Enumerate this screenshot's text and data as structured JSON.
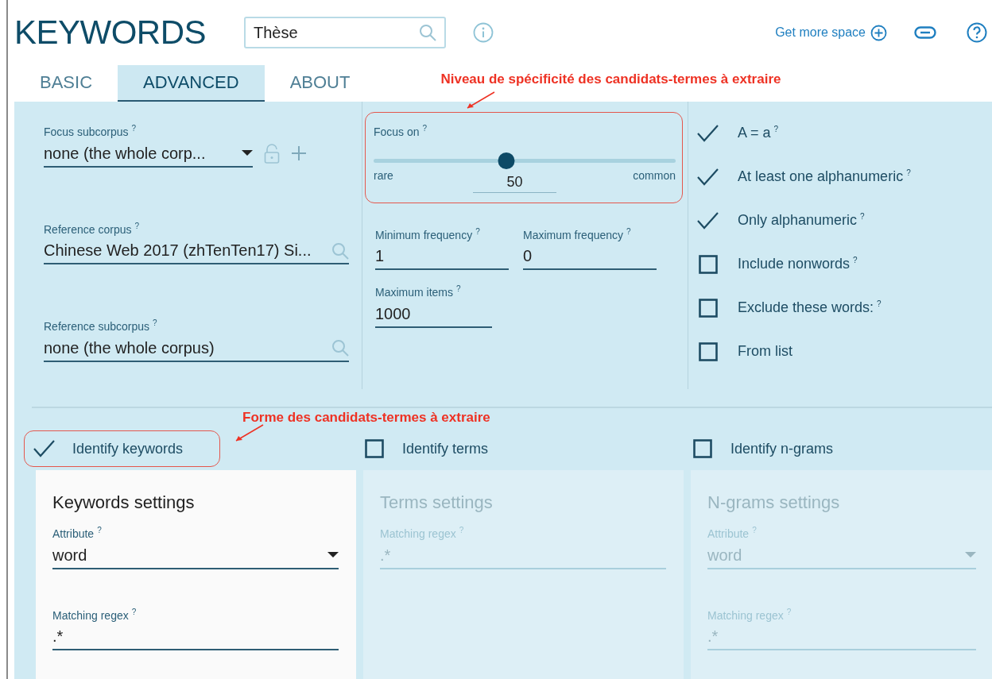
{
  "header": {
    "title": "KEYWORDS",
    "search": {
      "value": "Thèse"
    },
    "get_more_space": "Get more space"
  },
  "tabs": [
    {
      "label": "BASIC",
      "selected": false
    },
    {
      "label": "ADVANCED",
      "selected": true
    },
    {
      "label": "ABOUT",
      "selected": false
    }
  ],
  "annotations": [
    {
      "text": "Niveau de spécificité des candidats-termes à extraire"
    },
    {
      "text": "Forme des candidats-termes à extraire"
    }
  ],
  "corpus_fields": [
    {
      "kind": "dropdown",
      "label": "Focus subcorpus",
      "help_mark": "?",
      "value": "none (the whole corp..."
    },
    {
      "kind": "search",
      "label": "Reference corpus",
      "help_mark": "?",
      "value": "Chinese Web 2017 (zhTenTen17) Si..."
    },
    {
      "kind": "search",
      "label": "Reference subcorpus",
      "help_mark": "?",
      "value": "none (the whole corpus)"
    }
  ],
  "focus_on": {
    "label": "Focus on",
    "help_mark": "?",
    "level": 0.44,
    "min_label": "rare",
    "max_label": "common",
    "value": "50",
    "highlighted": true
  },
  "frequency_fields": [
    {
      "label": "Minimum frequency",
      "help_mark": "?",
      "value": "1"
    },
    {
      "label": "Maximum frequency",
      "help_mark": "?",
      "value": "0"
    },
    {
      "label": "Maximum items",
      "help_mark": "?",
      "value": "1000"
    }
  ],
  "options": [
    {
      "label": "A = a",
      "help_mark": "?",
      "checked": true
    },
    {
      "label": "At least one alphanumeric",
      "help_mark": "?",
      "checked": true
    },
    {
      "label": "Only alphanumeric",
      "help_mark": "?",
      "checked": true
    },
    {
      "label": "Include nonwords",
      "help_mark": "?",
      "checked": false
    },
    {
      "label": "Exclude these words:",
      "help_mark": "?",
      "checked": false
    },
    {
      "label": "From list",
      "checked": false
    }
  ],
  "modes": [
    {
      "label": "Identify keywords",
      "checked": true,
      "highlighted": true
    },
    {
      "label": "Identify terms",
      "checked": false,
      "highlighted": false
    },
    {
      "label": "Identify n-grams",
      "checked": false,
      "highlighted": false
    }
  ],
  "settings": [
    {
      "title": "Keywords settings",
      "disabled": false,
      "fields": [
        {
          "kind": "dropdown",
          "label": "Attribute",
          "help_mark": "?",
          "value": "word"
        },
        {
          "kind": "text",
          "label": "Matching regex",
          "help_mark": "?",
          "value": ".*"
        }
      ]
    },
    {
      "title": "Terms settings",
      "disabled": true,
      "fields": [
        {
          "kind": "text",
          "label": "Matching regex",
          "help_mark": "?",
          "value": ".*"
        }
      ]
    },
    {
      "title": "N-grams settings",
      "disabled": true,
      "fields": [
        {
          "kind": "dropdown",
          "label": "Attribute",
          "help_mark": "?",
          "value": "word"
        },
        {
          "kind": "text",
          "label": "Matching regex",
          "help_mark": "?",
          "value": ".*"
        }
      ]
    }
  ]
}
